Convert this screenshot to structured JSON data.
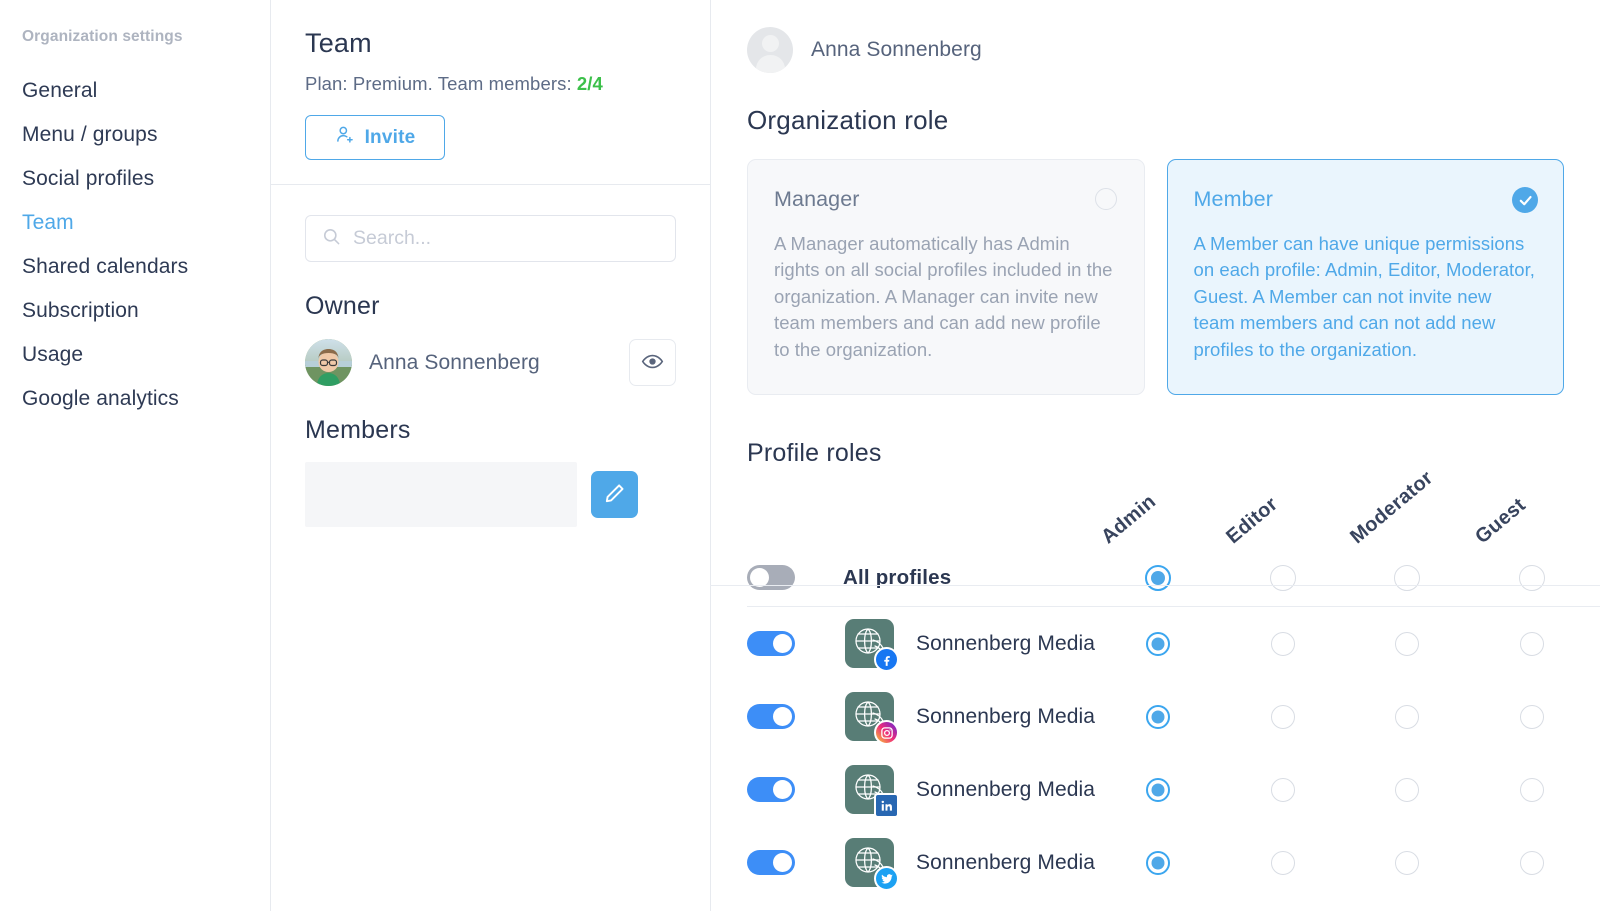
{
  "sidebar": {
    "title": "Organization settings",
    "items": [
      {
        "label": "General",
        "active": false
      },
      {
        "label": "Menu / groups",
        "active": false
      },
      {
        "label": "Social profiles",
        "active": false
      },
      {
        "label": "Team",
        "active": true
      },
      {
        "label": "Shared calendars",
        "active": false
      },
      {
        "label": "Subscription",
        "active": false
      },
      {
        "label": "Usage",
        "active": false
      },
      {
        "label": "Google analytics",
        "active": false
      }
    ]
  },
  "team": {
    "heading": "Team",
    "plan_prefix": "Plan: Premium. Team members: ",
    "members_count": "2/4",
    "invite_label": "Invite",
    "search_placeholder": "Search...",
    "search_value": "",
    "owner_heading": "Owner",
    "owner_name": "Anna Sonnenberg",
    "members_heading": "Members",
    "member_row_label": ""
  },
  "detail": {
    "user_name": "Anna Sonnenberg",
    "org_role_heading": "Organization role",
    "roles": [
      {
        "title": "Manager",
        "description": "A Manager automatically has Admin rights on all social profiles included in the organization. A Manager can invite new team members and can add new profile to the organization.",
        "selected": false
      },
      {
        "title": "Member",
        "description": "A Member can have unique permissions on each profile: Admin, Editor, Moderator, Guest. A Member can not invite new team members and can not add new profiles to the organization.",
        "selected": true
      }
    ],
    "profile_roles_heading": "Profile roles",
    "role_columns": [
      "Admin",
      "Editor",
      "Moderator",
      "Guest"
    ],
    "all_profiles_label": "All profiles",
    "all_profiles_toggle": false,
    "all_profiles_role": "Admin",
    "profiles": [
      {
        "name": "Sonnenberg Media",
        "network": "facebook",
        "enabled": true,
        "role": "Admin"
      },
      {
        "name": "Sonnenberg Media",
        "network": "instagram",
        "enabled": true,
        "role": "Admin"
      },
      {
        "name": "Sonnenberg Media",
        "network": "linkedin",
        "enabled": true,
        "role": "Admin"
      },
      {
        "name": "Sonnenberg Media",
        "network": "twitter",
        "enabled": true,
        "role": "Admin"
      }
    ]
  },
  "colors": {
    "accent": "#4fa8e8",
    "toggle_on": "#3d8ef7",
    "toggle_off": "#a8adb8",
    "count_green": "#3cc04a",
    "text_dark": "#2b3751",
    "profile_avatar": "#587d76"
  }
}
